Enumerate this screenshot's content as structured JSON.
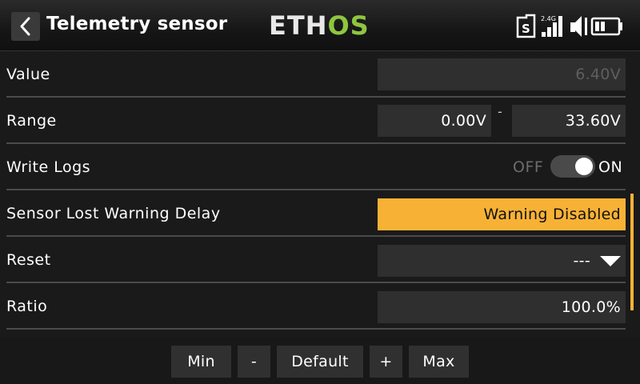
{
  "header": {
    "title": "Telemetry sensor",
    "logo_left": "ETH",
    "logo_right": "OS",
    "icons": [
      "back-icon",
      "sd-card-icon",
      "signal-icon",
      "speaker-icon",
      "battery-icon"
    ],
    "signal_band": "2.4G",
    "sd_label": "S"
  },
  "rows": {
    "value": {
      "label": "Value",
      "value": "6.40V"
    },
    "range": {
      "label": "Range",
      "min": "0.00V",
      "sep": "-",
      "max": "33.60V"
    },
    "write_logs": {
      "label": "Write Logs",
      "off": "OFF",
      "on": "ON",
      "state": "on"
    },
    "sensor_lost": {
      "label": "Sensor Lost Warning Delay",
      "value": "Warning Disabled"
    },
    "reset": {
      "label": "Reset",
      "value": "---"
    },
    "ratio": {
      "label": "Ratio",
      "value": "100.0%"
    }
  },
  "footer": {
    "min": "Min",
    "dec": "-",
    "default": "Default",
    "inc": "+",
    "max": "Max"
  },
  "colors": {
    "accent": "#f7b236",
    "logo_green": "#8ec63f",
    "background": "#1b1b1b",
    "field": "#2f2f2f"
  }
}
